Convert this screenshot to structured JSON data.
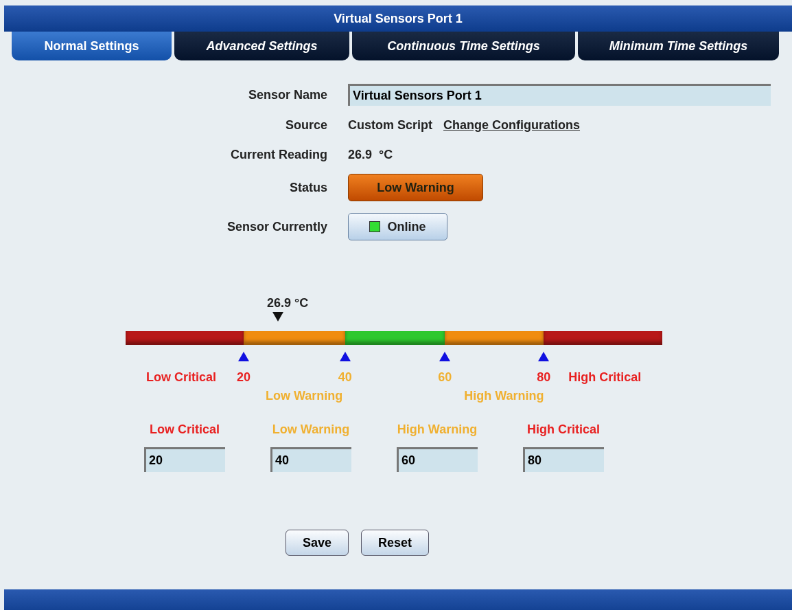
{
  "window": {
    "title": "Virtual Sensors Port 1"
  },
  "tabs": [
    {
      "label": "Normal Settings",
      "selected": true
    },
    {
      "label": "Advanced Settings",
      "selected": false
    },
    {
      "label": "Continuous Time Settings",
      "selected": false
    },
    {
      "label": "Minimum Time Settings",
      "selected": false
    }
  ],
  "form": [
    {
      "kind": "input",
      "label": "Sensor Name",
      "value": "Virtual Sensors Port 1"
    },
    {
      "kind": "link",
      "label": "Source",
      "value": "Custom Script",
      "link": "Change Configurations"
    },
    {
      "kind": "text",
      "label": "Current Reading",
      "value": "26.9  °C"
    },
    {
      "kind": "status",
      "label": "Status",
      "value": "Low Warning"
    },
    {
      "kind": "state",
      "label": "Sensor Currently",
      "value": "Online",
      "on": true
    }
  ],
  "gauge": {
    "reading": "26.9 °C",
    "level": 0.284,
    "segments": [
      {
        "color": "#b81818"
      },
      {
        "color": "#f08c10"
      },
      {
        "color": "#2ec82e"
      },
      {
        "color": "#f08c10"
      },
      {
        "color": "#b81818"
      }
    ],
    "markers": [
      {
        "value": "20",
        "color": "#e82020",
        "level": 0.22
      },
      {
        "value": "40",
        "color": "#f0b030",
        "level": 0.409
      },
      {
        "value": "60",
        "color": "#f0b030",
        "level": 0.595
      },
      {
        "value": "80",
        "color": "#e82020",
        "level": 0.779
      }
    ],
    "zones": [
      {
        "kind": "before",
        "label": "Low Critical",
        "color": "#e82020"
      },
      {
        "kind": "between",
        "label": "Low Warning",
        "color": "#f0b030"
      },
      {
        "kind": "between",
        "label": "High Warning",
        "color": "#f0b030"
      },
      {
        "kind": "after",
        "label": "High Critical",
        "color": "#e82020"
      }
    ]
  },
  "thresholds": [
    {
      "label": "Low Critical",
      "color": "#e82020",
      "value": "20"
    },
    {
      "label": "Low Warning",
      "color": "#f0b030",
      "value": "40"
    },
    {
      "label": "High Warning",
      "color": "#f0b030",
      "value": "60"
    },
    {
      "label": "High Critical",
      "color": "#e82020",
      "value": "80"
    }
  ],
  "buttons": [
    "Save",
    "Reset"
  ]
}
